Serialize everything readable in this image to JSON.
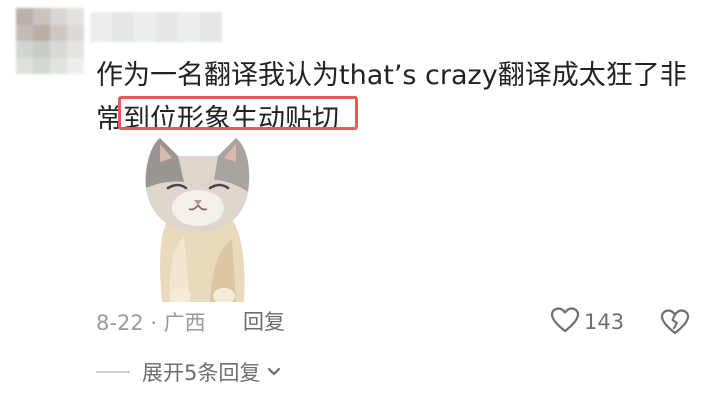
{
  "comment": {
    "line1": "作为一名翻译我认为that’s crazy翻译成太狂了非",
    "line2_prefix": "常",
    "line2_highlight": "到位形象生动贴切"
  },
  "meta": {
    "date_location": "8-22 · 广西",
    "reply_label": "回复"
  },
  "actions": {
    "like_count": "143",
    "like_icon": "heart-outline-icon",
    "dislike_icon": "broken-heart-icon"
  },
  "thread": {
    "expand_label": "展开5条回复",
    "expand_icon": "chevron-down-icon"
  },
  "colors": {
    "highlight_border": "#f0575d",
    "text_primary": "#222222",
    "text_secondary": "#9a9a9a"
  }
}
